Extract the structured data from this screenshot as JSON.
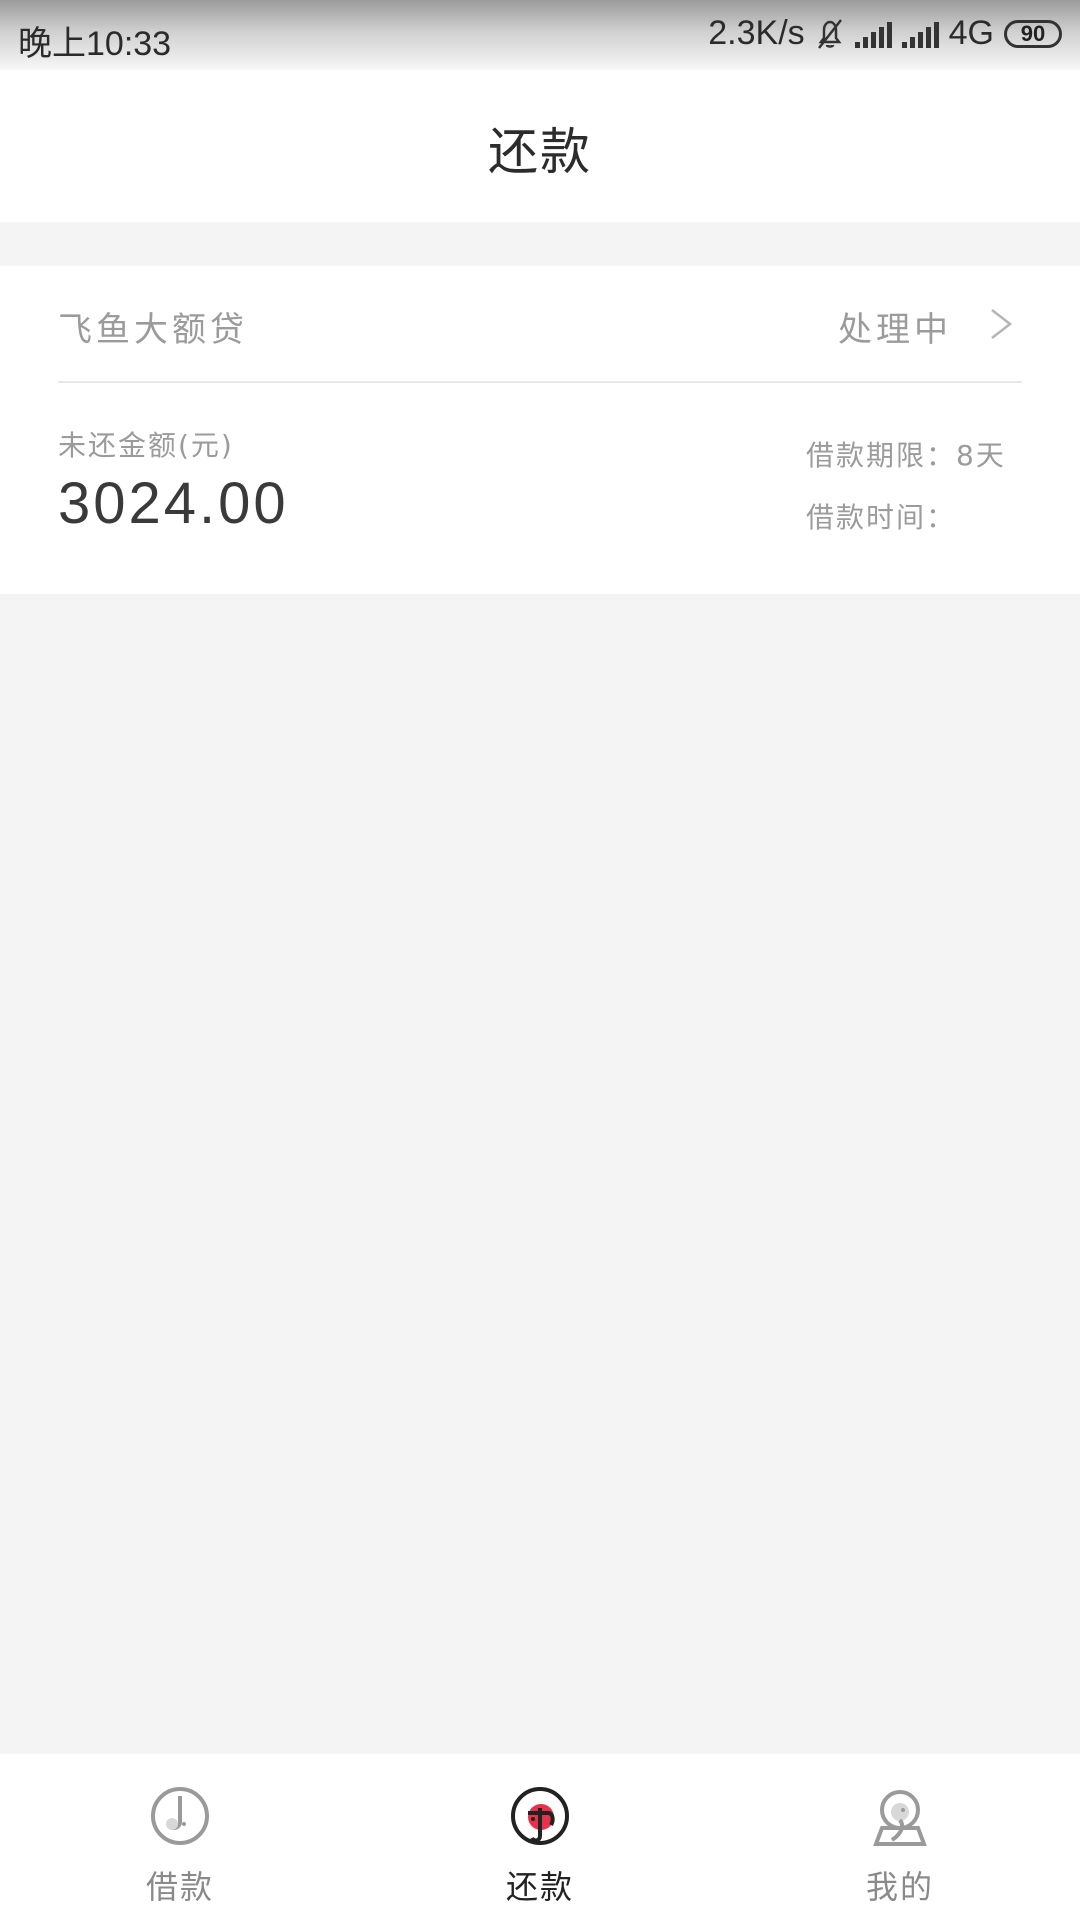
{
  "status_bar": {
    "time": "晚上10:33",
    "speed": "2.3K/s",
    "network": "4G",
    "battery": "90"
  },
  "header": {
    "title": "还款"
  },
  "loan": {
    "name": "飞鱼大额贷",
    "status": "处理中",
    "amount_label": "未还金额(元)",
    "amount": "3024.00",
    "term": "借款期限：8天",
    "time_label": "借款时间："
  },
  "nav": {
    "items": [
      {
        "label": "借款",
        "icon": "borrow-icon",
        "active": false
      },
      {
        "label": "还款",
        "icon": "repay-icon",
        "active": true
      },
      {
        "label": "我的",
        "icon": "profile-icon",
        "active": false
      }
    ]
  },
  "colors": {
    "accent": "#e8324b",
    "background": "#f4f4f4",
    "muted_text": "#9b9b9b"
  }
}
